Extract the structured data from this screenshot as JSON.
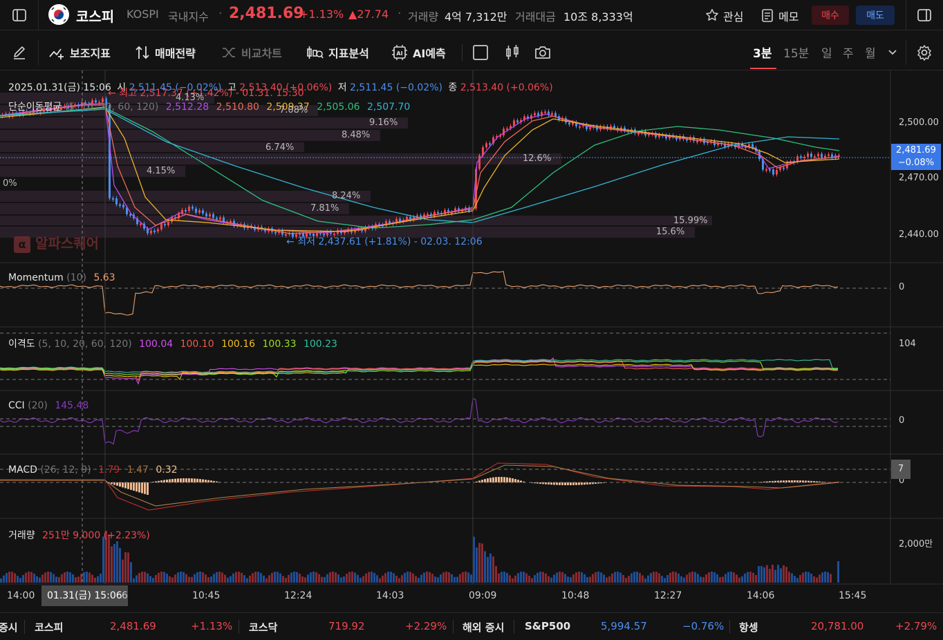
{
  "header": {
    "name": "코스피",
    "code": "KOSPI",
    "market": "국내지수",
    "price": "2,481.69",
    "change_pct": "+1.13%",
    "change_abs": "▲27.74",
    "volume_label": "거래량",
    "volume": "4억 7,312만",
    "amount_label": "거래대금",
    "amount": "10조 8,333억",
    "watch_label": "관심",
    "memo_label": "메모",
    "buy_label": "매수",
    "sell_label": "매도"
  },
  "toolbar": {
    "indicator_label": "보조지표",
    "strategy_label": "매매전략",
    "compare_label": "비교차트",
    "analysis_label": "지표분석",
    "ai_label": "AI예측",
    "timeframes": [
      "3분",
      "15분",
      "일",
      "주",
      "월"
    ],
    "active_timeframe": "3분"
  },
  "chart": {
    "ohlc": {
      "datetime": "2025.01.31(금) 15:06",
      "open_label": "시",
      "open": "2,511.45 (−0.02%)",
      "high_label": "고",
      "high": "2,513.40 (+0.06%)",
      "low_label": "저",
      "low": "2,511.45 (−0.02%)",
      "close_label": "종",
      "close": "2,513.40 (+0.06%)"
    },
    "ma": {
      "label": "단순이동평균",
      "params": "(5, 10, 20, 60, 120)",
      "values": [
        "2,512.28",
        "2,510.80",
        "2,509.37",
        "2,505.06",
        "2,507.70"
      ]
    },
    "high_marker": "최고 2,517.37 (+1.42%) - 01.31. 15:30",
    "low_marker": "최저 2,437.61 (+1.81%) - 02.03. 12:06",
    "watermark": "알파스퀘어",
    "y_ticks": [
      "2,500.00",
      "2,470.00",
      "2,440.00"
    ],
    "price_tag": "2,481.69",
    "price_tag_pct": "−0.08%",
    "volume_profile": [
      "4.13%",
      "7.08%",
      "9.16%",
      "8.48%",
      "6.74%",
      "12.6%",
      "4.15%",
      "0%",
      "8.24%",
      "7.81%",
      "15.99%",
      "15.6%"
    ],
    "x_ticks": [
      "14:00",
      "10:45",
      "12:24",
      "14:03",
      "09:09",
      "10:48",
      "12:27",
      "14:06",
      "15:45"
    ],
    "crosshair_time": "01.31(금) 15:06",
    "crosshair_suffix": "6"
  },
  "panels": {
    "momentum": {
      "name": "Momentum",
      "params": "(10)",
      "value": "5.63",
      "tick": "0"
    },
    "disparity": {
      "name": "이격도",
      "params": "(5, 10, 20, 60, 120)",
      "values": [
        "100.04",
        "100.10",
        "100.16",
        "100.33",
        "100.23"
      ],
      "tick": "104"
    },
    "cci": {
      "name": "CCI",
      "params": "(20)",
      "value": "145.48",
      "tick": "0"
    },
    "macd": {
      "name": "MACD",
      "params": "(26, 12, 9)",
      "values": [
        "1.79",
        "1.47",
        "0.32"
      ],
      "tick": "0",
      "tag": "7"
    },
    "volume": {
      "name": "거래량",
      "value": "251만 9,000 (+2.23%)",
      "tick": "2,000만"
    }
  },
  "bottom": {
    "label_cut": "증시",
    "kospi_name": "코스피",
    "kospi_val": "2,481.69",
    "kospi_chg": "+1.13%",
    "kosdaq_name": "코스닥",
    "kosdaq_val": "719.92",
    "kosdaq_chg": "+2.29%",
    "overseas_label": "해외 증시",
    "sp_name": "S&P500",
    "sp_val": "5,994.57",
    "sp_chg": "−0.76%",
    "hs_name": "항셍",
    "hs_val": "20,781.00",
    "hs_chg": "+2.79%"
  },
  "colors": {
    "up": "#f0474f",
    "down": "#4b8ff0",
    "ma5": "#b34df0",
    "ma10": "#f06a5a",
    "ma20": "#f0b429",
    "ma60": "#2ec27e",
    "ma120": "#33b5d6"
  }
}
